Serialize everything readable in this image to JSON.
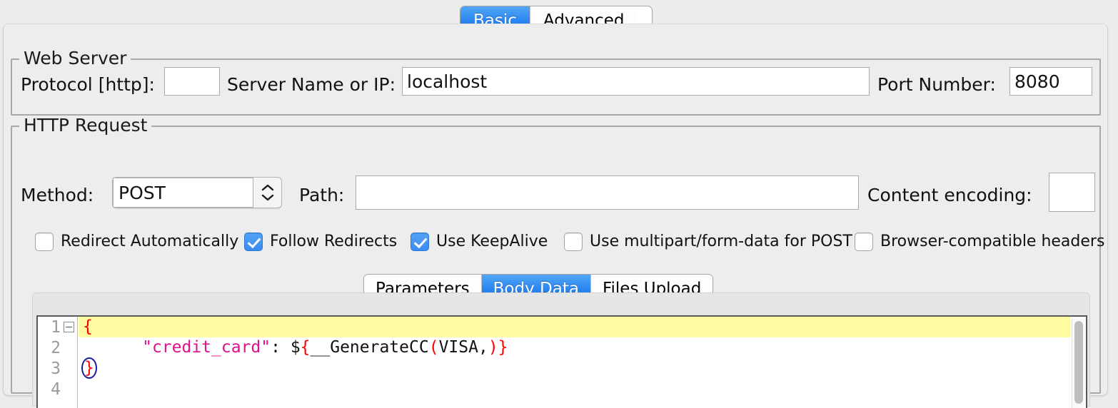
{
  "top_tabs": {
    "items": [
      {
        "label": "Basic",
        "active": true
      },
      {
        "label": "Advanced",
        "active": false
      }
    ]
  },
  "web_server": {
    "title": "Web Server",
    "protocol_label": "Protocol [http]:",
    "protocol_value": "",
    "server_label": "Server Name or IP:",
    "server_value": "localhost",
    "port_label": "Port Number:",
    "port_value": "8080"
  },
  "http_request": {
    "title": "HTTP Request",
    "method_label": "Method:",
    "method_value": "POST",
    "path_label": "Path:",
    "path_value": "",
    "content_encoding_label": "Content encoding:",
    "content_encoding_value": "",
    "checkboxes": [
      {
        "label": "Redirect Automatically",
        "checked": false
      },
      {
        "label": "Follow Redirects",
        "checked": true
      },
      {
        "label": "Use KeepAlive",
        "checked": true
      },
      {
        "label": "Use multipart/form-data for POST",
        "checked": false
      },
      {
        "label": "Browser-compatible headers",
        "checked": false
      }
    ],
    "sub_tabs": [
      {
        "label": "Parameters",
        "active": false
      },
      {
        "label": "Body Data",
        "active": true
      },
      {
        "label": "Files Upload",
        "active": false
      }
    ]
  },
  "editor": {
    "line_numbers": [
      "1",
      "2",
      "3",
      "4"
    ],
    "line1_brace": "{",
    "line2_key": "\"credit_card\"",
    "line2_colon": ":",
    "line2_dollar": " $",
    "line2_open": "{",
    "line2_func": "__GenerateCC",
    "line2_paren_open": "(",
    "line2_arg": "VISA,",
    "line2_paren_close": ")",
    "line2_close": "}",
    "line3_brace": "}",
    "indent": "      "
  },
  "colors": {
    "accent_blue": "#2b86f0",
    "highlight_yellow": "#fffba0",
    "syntax_red": "#ff0000",
    "syntax_magenta": "#e0118c",
    "window_bg": "#ececec"
  }
}
